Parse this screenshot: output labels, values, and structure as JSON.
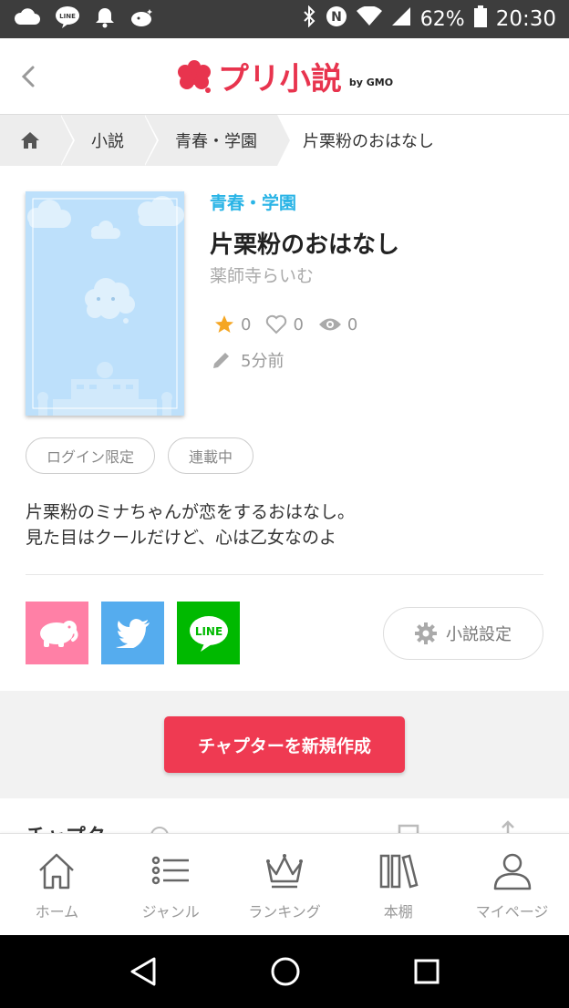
{
  "status_bar": {
    "battery": "62%",
    "time": "20:30",
    "icons": [
      "cloud-icon",
      "line-app-icon",
      "bell-icon",
      "pixiv-icon",
      "bluetooth-icon",
      "nfc-icon",
      "wifi-icon",
      "signal-icon",
      "battery-icon"
    ]
  },
  "header": {
    "logo_text": "プリ小説",
    "logo_sub": "by GMO"
  },
  "breadcrumb": {
    "items": [
      "小説",
      "青春・学園"
    ],
    "current": "片栗粉のおはなし"
  },
  "novel": {
    "genre": "青春・学園",
    "title": "片栗粉のおはなし",
    "author": "薬師寺らいむ",
    "stars": "0",
    "likes": "0",
    "views": "0",
    "updated": "5分前",
    "tags": [
      "ログイン限定",
      "連載中"
    ],
    "description_line1": "片栗粉のミナちゃんが恋をするおはなし。",
    "description_line2": "見た目はクールだけど、心は乙女なのよ"
  },
  "share": {
    "line_label": "LINE"
  },
  "settings_label": "小説設定",
  "create_chapter_label": "チャプターを新規作成",
  "chapter_header": "チャプター",
  "nav": {
    "items": [
      {
        "label": "ホーム",
        "icon": "house-icon"
      },
      {
        "label": "ジャンル",
        "icon": "list-icon"
      },
      {
        "label": "ランキング",
        "icon": "crown-icon"
      },
      {
        "label": "本棚",
        "icon": "bookshelf-icon"
      },
      {
        "label": "マイページ",
        "icon": "person-icon"
      }
    ]
  },
  "colors": {
    "brand": "#e8344e",
    "genre": "#2ab4e6",
    "cover_bg": "#bde0fb",
    "pixiv_share": "#ff80a6",
    "twitter_share": "#55acee",
    "line_share": "#00b900"
  }
}
